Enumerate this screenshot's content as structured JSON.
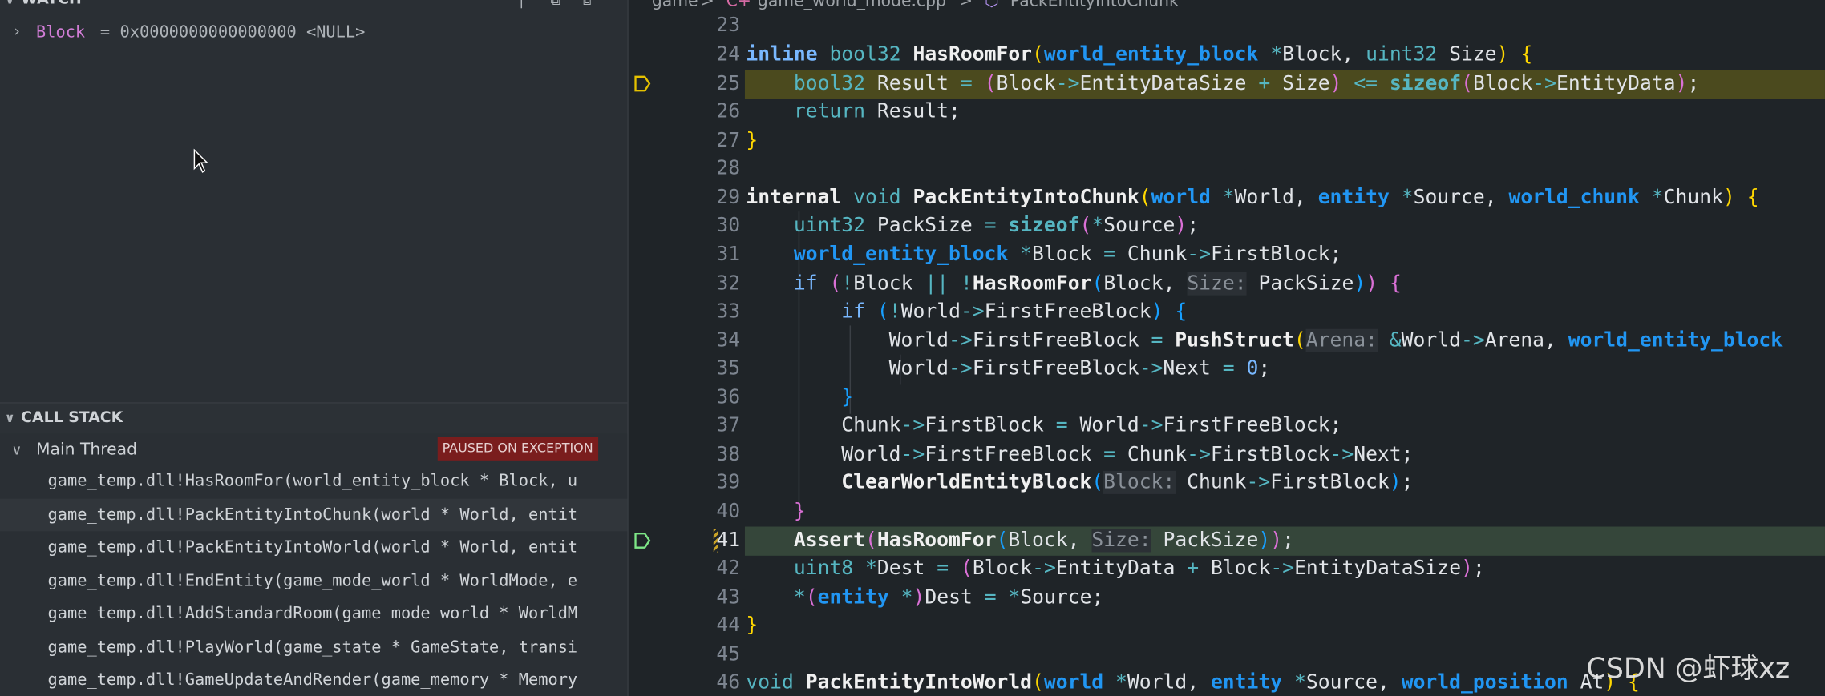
{
  "watch": {
    "title": "WATCH",
    "items": [
      {
        "name": "Block",
        "eq": "=",
        "value": "0x0000000000000000 <NULL>"
      }
    ]
  },
  "call_stack": {
    "title": "CALL STACK",
    "thread": "Main Thread",
    "status": "PAUSED ON EXCEPTION",
    "frames": [
      "game_temp.dll!HasRoomFor(world_entity_block * Block, u",
      "game_temp.dll!PackEntityIntoChunk(world * World, entit",
      "game_temp.dll!PackEntityIntoWorld(world * World, entit",
      "game_temp.dll!EndEntity(game_mode_world * WorldMode, e",
      "game_temp.dll!AddStandardRoom(game_mode_world * WorldM",
      "game_temp.dll!PlayWorld(game_state * GameState, transi",
      "game_temp.dll!GameUpdateAndRender(game_memory * Memory"
    ]
  },
  "breadcrumb": {
    "folder": "game",
    "sep": ">",
    "file": "game_world_mode.cpp",
    "symbol": "PackEntityIntoChunk"
  },
  "editor": {
    "line_numbers": [
      "23",
      "24",
      "25",
      "26",
      "27",
      "28",
      "29",
      "30",
      "31",
      "32",
      "33",
      "34",
      "35",
      "36",
      "37",
      "38",
      "39",
      "40",
      "41",
      "42",
      "43",
      "44",
      "45",
      "46"
    ],
    "current_line": "41"
  },
  "watermark": "CSDN @虾球xz",
  "colors": {
    "exception_badge": "#7a1d1d",
    "highlight_exception": "#4b4a1e",
    "highlight_current": "#35463a",
    "keyword": "#79b8ff",
    "type": "#2196f3"
  }
}
